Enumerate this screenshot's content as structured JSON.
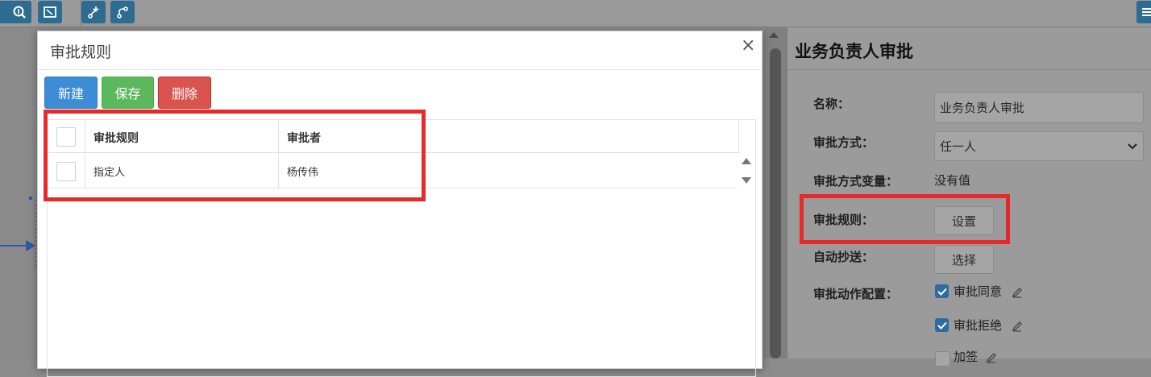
{
  "colors": {
    "primary": "#3c8dd6",
    "success": "#5cb85c",
    "danger": "#d9534f",
    "toolbar_icon": "#2e6b91",
    "highlight": "#e8292a"
  },
  "toolbar": {
    "icons": [
      "zoom-in-icon",
      "fit-screen-icon",
      "add-node-icon",
      "branch-icon",
      "menu-icon"
    ]
  },
  "modal": {
    "title": "审批规则",
    "close": "×",
    "buttons": {
      "new": "新建",
      "save": "保存",
      "delete": "删除"
    },
    "table": {
      "headers": [
        "审批规则",
        "审批者"
      ],
      "rows": [
        {
          "rule": "指定人",
          "approver": "杨传伟"
        }
      ]
    }
  },
  "panel": {
    "title": "业务负责人审批",
    "name_label": "名称：",
    "name_value": "业务负责人审批",
    "method_label": "审批方式：",
    "method_value": "任一人",
    "method_var_label": "审批方式变量：",
    "method_var_value": "没有值",
    "rule_label": "审批规则：",
    "rule_button": "设置",
    "cc_label": "自动抄送：",
    "cc_button": "选择",
    "action_label": "审批动作配置：",
    "actions": [
      "审批同意",
      "审批拒绝",
      "加签"
    ]
  }
}
